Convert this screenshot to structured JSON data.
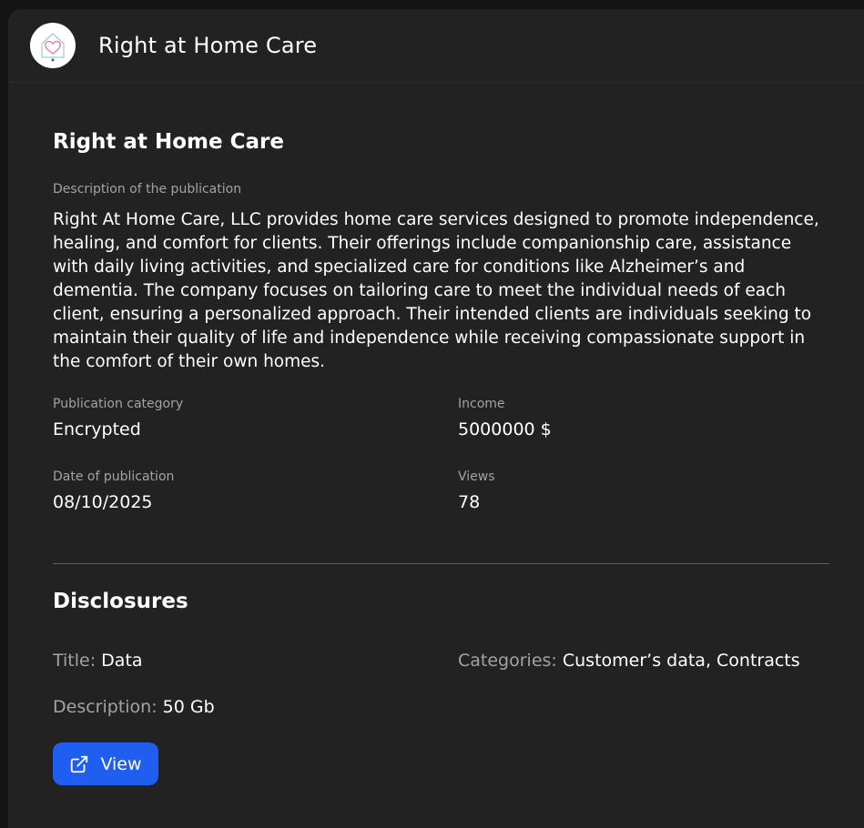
{
  "header": {
    "title": "Right at Home Care",
    "logo_icon": "heart-house-logo"
  },
  "publication": {
    "title": "Right at Home Care",
    "description_label": "Description of the publication",
    "description": "Right At Home Care, LLC provides home care services designed to promote independence, healing, and comfort for clients. Their offerings include companionship care, assistance with daily living activities, and specialized care for conditions like Alzheimer’s and dementia. The company focuses on tailoring care to meet the individual needs of each client, ensuring a personalized approach. Their intended clients are individuals seeking to maintain their quality of life and independence while receiving compassionate support in the comfort of their own homes.",
    "category_label": "Publication category",
    "category": "Encrypted",
    "income_label": "Income",
    "income": "5000000 $",
    "date_label": "Date of publication",
    "date": "08/10/2025",
    "views_label": "Views",
    "views": "78"
  },
  "disclosures": {
    "heading": "Disclosures",
    "title_key": "Title:",
    "title_value": "Data",
    "categories_key": "Categories:",
    "categories_value": "Customer’s data, Contracts",
    "description_key": "Description:",
    "description_value": "50 Gb",
    "view_button_label": "View",
    "view_button_icon": "external-link-icon"
  },
  "colors": {
    "background": "#141414",
    "card": "#222222",
    "accent": "#1f5ef0",
    "divider": "#3d5bb8",
    "muted_text": "#a3a3a3"
  }
}
